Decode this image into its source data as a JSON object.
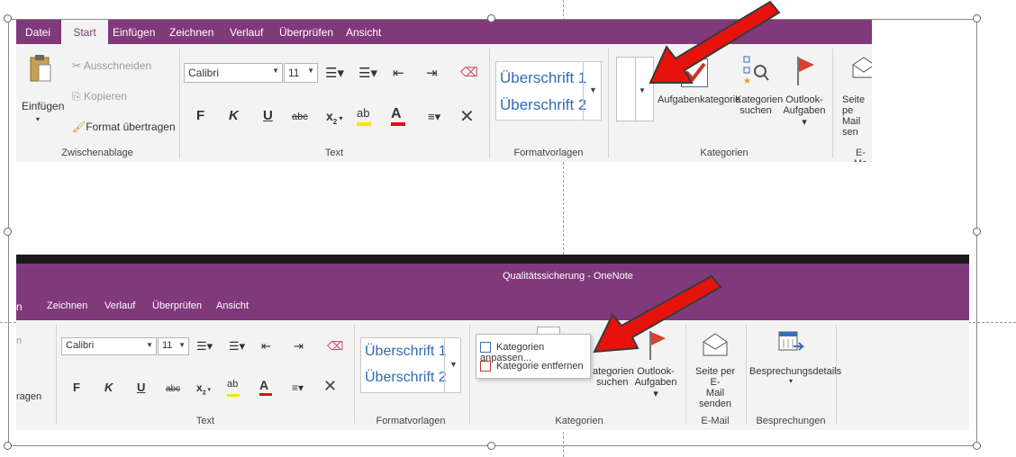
{
  "top_ribbon": {
    "tabs": [
      "Datei",
      "Start",
      "Einfügen",
      "Zeichnen",
      "Verlauf",
      "Überprüfen",
      "Ansicht"
    ],
    "clipboard": {
      "paste": "Einfügen",
      "cut": "Ausschneiden",
      "copy": "Kopieren",
      "format_painter": "Format übertragen",
      "group_label": "Zwischenablage"
    },
    "text": {
      "font_name": "Calibri",
      "font_size": "11",
      "bold": "F",
      "italic": "K",
      "underline": "U",
      "strike": "abc",
      "subscript": "x",
      "group_label": "Text"
    },
    "styles": {
      "heading1": "Überschrift 1",
      "heading2": "Überschrift 2",
      "group_label": "Formatvorlagen"
    },
    "categories": {
      "task_category": "Aufgabenkategorie",
      "find_categories_1": "Kategorien",
      "find_categories_2": "suchen",
      "outlook_tasks_1": "Outlook-",
      "outlook_tasks_2": "Aufgaben",
      "group_label": "Kategorien"
    },
    "email": {
      "send_1": "Seite pe",
      "send_2": "Mail sen",
      "group_label": "E-Ma"
    }
  },
  "bottom_ribbon": {
    "window_title": "Qualitätssicherung  -  OneNote",
    "tabs": [
      "n",
      "Zeichnen",
      "Verlauf",
      "Überprüfen",
      "Ansicht"
    ],
    "clipboard_partial": "ragen",
    "text": {
      "font_name": "Calibri",
      "font_size": "11",
      "bold": "F",
      "italic": "K",
      "underline": "U",
      "strike": "abc",
      "subscript": "x",
      "group_label": "Text"
    },
    "styles": {
      "heading1": "Überschrift 1",
      "heading2": "Überschrift 2",
      "group_label": "Formatvorlagen"
    },
    "dropdown_menu": {
      "customize": "Kategorien anpassen...",
      "remove": "Kategorie entfernen"
    },
    "categories": {
      "find_1": "ategorien",
      "find_2": "suchen",
      "outlook_tasks_1": "Outlook-",
      "outlook_tasks_2": "Aufgaben",
      "group_label": "Kategorien"
    },
    "email": {
      "send_1": "Seite per E-",
      "send_2": "Mail senden",
      "group_label": "E-Mail"
    },
    "meetings": {
      "details": "Besprechungsdetails",
      "group_label": "Besprechungen"
    }
  },
  "colors": {
    "ribbon_purple": "#80397b",
    "arrow_red": "#e8120c",
    "heading_blue": "#2e6db4"
  }
}
